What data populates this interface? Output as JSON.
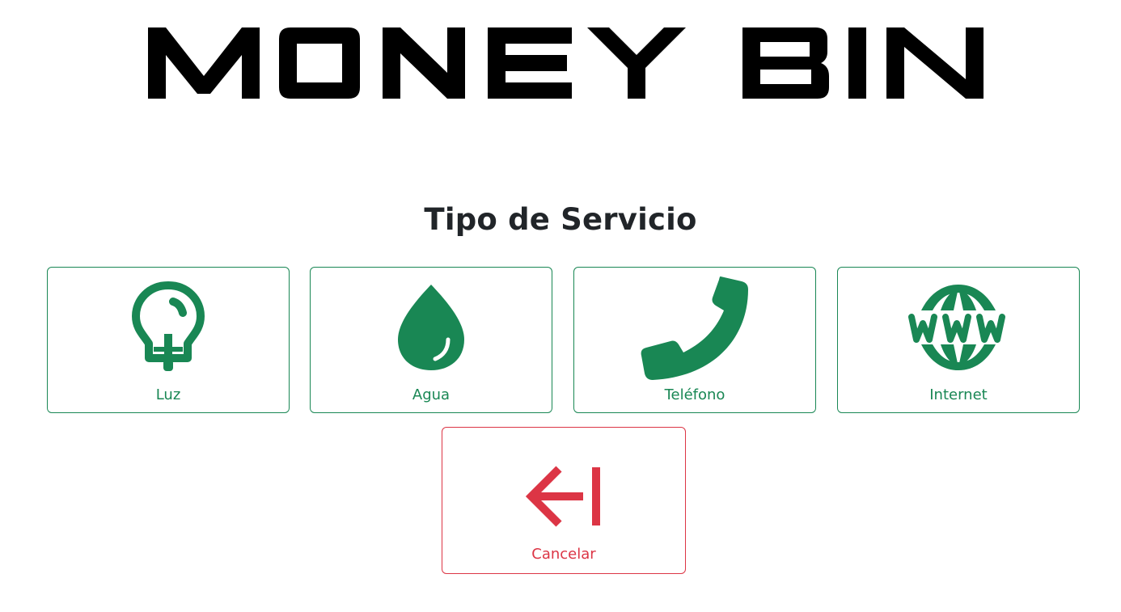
{
  "brand": {
    "logo_text": "MONEY BIN"
  },
  "main": {
    "title": "Tipo de Servicio",
    "services": [
      {
        "label": "Luz",
        "icon": "lightbulb-icon"
      },
      {
        "label": "Agua",
        "icon": "droplet-icon"
      },
      {
        "label": "Teléfono",
        "icon": "phone-icon"
      },
      {
        "label": "Internet",
        "icon": "globe-www-icon"
      }
    ],
    "cancel": {
      "label": "Cancelar",
      "icon": "exit-arrow-icon"
    }
  },
  "colors": {
    "success": "#198754",
    "danger": "#dc3545",
    "text": "#212529"
  }
}
